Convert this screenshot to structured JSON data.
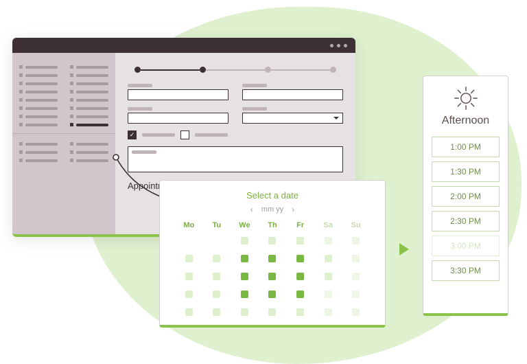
{
  "colors": {
    "accent": "#8bc34a",
    "accent_dark": "#7bb043",
    "ink": "#3d2f36",
    "blob": "#dff0cf"
  },
  "browser": {
    "window_dots": 3,
    "appointment_label": "Appointment"
  },
  "calendar": {
    "title": "Select a date",
    "month_label": "mm yy",
    "prev_icon": "‹",
    "next_icon": "›",
    "days": [
      "Mo",
      "Tu",
      "We",
      "Th",
      "Fr",
      "Sa",
      "Su"
    ]
  },
  "time": {
    "heading": "Afternoon",
    "icon": "sun-icon",
    "slots": [
      {
        "label": "1:00 PM",
        "disabled": false
      },
      {
        "label": "1:30 PM",
        "disabled": false
      },
      {
        "label": "2:00 PM",
        "disabled": false
      },
      {
        "label": "2:30 PM",
        "disabled": false
      },
      {
        "label": "3:00 PM",
        "disabled": true
      },
      {
        "label": "3:30 PM",
        "disabled": false
      }
    ]
  }
}
